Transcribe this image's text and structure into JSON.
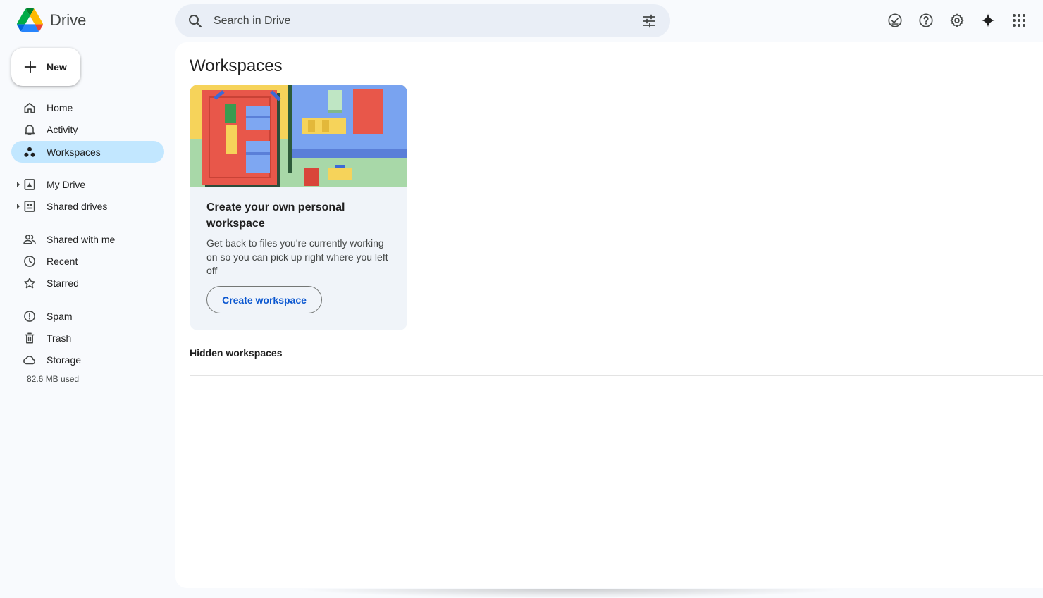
{
  "app": {
    "name": "Drive"
  },
  "search": {
    "placeholder": "Search in Drive"
  },
  "top_icons": [
    "ready-for-offline-icon",
    "help-icon",
    "settings-icon",
    "gemini-icon",
    "apps-grid-icon"
  ],
  "sidebar": {
    "new_label": "New",
    "items": [
      {
        "label": "Home",
        "icon": "home-icon"
      },
      {
        "label": "Activity",
        "icon": "bell-icon"
      },
      {
        "label": "Workspaces",
        "icon": "workspaces-icon",
        "active": true
      },
      {
        "label": "My Drive",
        "icon": "my-drive-icon",
        "expandable": true
      },
      {
        "label": "Shared drives",
        "icon": "shared-drives-icon",
        "expandable": true
      },
      {
        "label": "Shared with me",
        "icon": "people-icon"
      },
      {
        "label": "Recent",
        "icon": "clock-icon"
      },
      {
        "label": "Starred",
        "icon": "star-icon"
      },
      {
        "label": "Spam",
        "icon": "spam-icon"
      },
      {
        "label": "Trash",
        "icon": "trash-icon"
      },
      {
        "label": "Storage",
        "icon": "cloud-icon"
      }
    ],
    "storage_used": "82.6 MB used"
  },
  "main": {
    "title": "Workspaces",
    "card": {
      "title": "Create your own personal workspace",
      "description": "Get back to files you're currently working on so you can pick up right where you left off",
      "button_label": "Create workspace"
    },
    "hidden_workspaces_label": "Hidden workspaces"
  },
  "colors": {
    "active_nav": "#c2e7ff",
    "search_bg": "#e9eef6",
    "link_blue": "#0b57d0",
    "page_bg": "#f8fafd"
  }
}
